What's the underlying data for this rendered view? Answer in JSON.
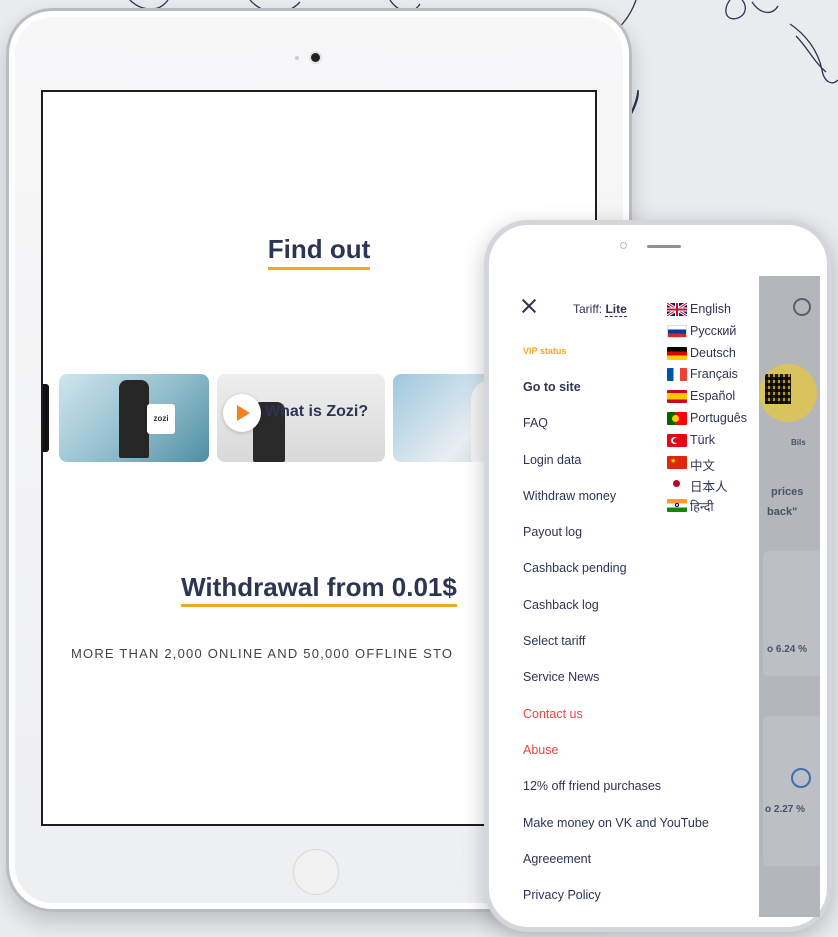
{
  "tablet": {
    "find_out": "Find out",
    "video_title": "What is Zozi?",
    "bag_text": "zozi",
    "withdrawal": "Withdrawal from 0.01$",
    "more_than": "MORE THAN 2,000 ONLINE AND 50,000 OFFLINE STO"
  },
  "phone_menu": {
    "tariff_label": "Tariff: ",
    "tariff_value": "Lite",
    "vip_status": "VIP status",
    "items": [
      {
        "label": "Go to site"
      },
      {
        "label": "FAQ"
      },
      {
        "label": "Login data"
      },
      {
        "label": "Withdraw money"
      },
      {
        "label": "Payout log"
      },
      {
        "label": "Cashback pending"
      },
      {
        "label": "Cashback log"
      },
      {
        "label": "Select tariff"
      },
      {
        "label": "Service News"
      },
      {
        "label": "Contact us"
      },
      {
        "label": "Abuse"
      },
      {
        "label": "12% off friend purchases"
      },
      {
        "label": "Make money on VK and YouTube"
      },
      {
        "label": "Agreeement"
      },
      {
        "label": "Privacy Policy"
      }
    ],
    "languages": [
      {
        "label": "English"
      },
      {
        "label": "Русский"
      },
      {
        "label": "Deutsch"
      },
      {
        "label": "Français"
      },
      {
        "label": "Español"
      },
      {
        "label": "Português"
      },
      {
        "label": "Türk"
      },
      {
        "label": "中文"
      },
      {
        "label": "日本人"
      },
      {
        "label": "हिन्दी"
      }
    ]
  },
  "phone_background": {
    "bils": "Bils",
    "prices": "prices",
    "back": "back\"",
    "pct1": "o 6.24 %",
    "pct2": "o 2.27 %"
  },
  "colors": {
    "navy": "#2e3453",
    "orange": "#f5a623",
    "red": "#e84545"
  }
}
